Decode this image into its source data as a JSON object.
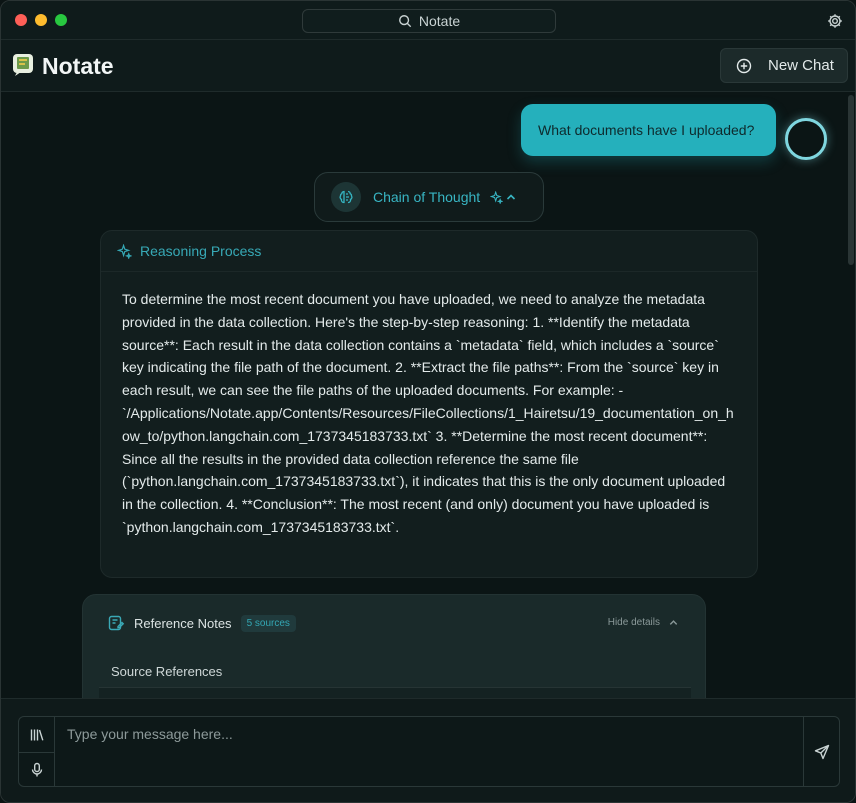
{
  "window": {
    "title": "Notate"
  },
  "header": {
    "app_name": "Notate",
    "new_chat_label": "New Chat"
  },
  "chat": {
    "user_message": "What documents have I uploaded?",
    "chain_of_thought_label": "Chain of Thought",
    "reasoning": {
      "title": "Reasoning Process",
      "text": "To determine the most recent document you have uploaded, we need to analyze the metadata provided in the data collection. Here's the step-by-step reasoning: 1. **Identify the metadata source**: Each result in the data collection contains a `metadata` field, which includes a `source` key indicating the file path of the document. 2. **Extract the file paths**: From the `source` key in each result, we can see the file paths of the uploaded documents. For example: - `/Applications/Notate.app/Contents/Resources/FileCollections/1_Hairetsu/19_documentation_on_how_to/python.langchain.com_1737345183733.txt` 3. **Determine the most recent document**: Since all the results in the provided data collection reference the same file (`python.langchain.com_1737345183733.txt`), it indicates that this is the only document uploaded in the collection. 4. **Conclusion**: The most recent (and only) document you have uploaded is `python.langchain.com_1737345183733.txt`."
    },
    "references": {
      "title": "Reference Notes",
      "badge": "5 sources",
      "hide_label": "Hide details",
      "section_label": "Source References"
    }
  },
  "composer": {
    "placeholder": "Type your message here..."
  },
  "colors": {
    "accent": "#25b0bc",
    "background": "#0b1515"
  },
  "icons": [
    "search-icon",
    "gear-icon",
    "plus-circle-icon",
    "brain-icon",
    "sparkle-icon",
    "chevron-up-icon",
    "notes-icon",
    "library-icon",
    "microphone-icon",
    "send-icon"
  ]
}
